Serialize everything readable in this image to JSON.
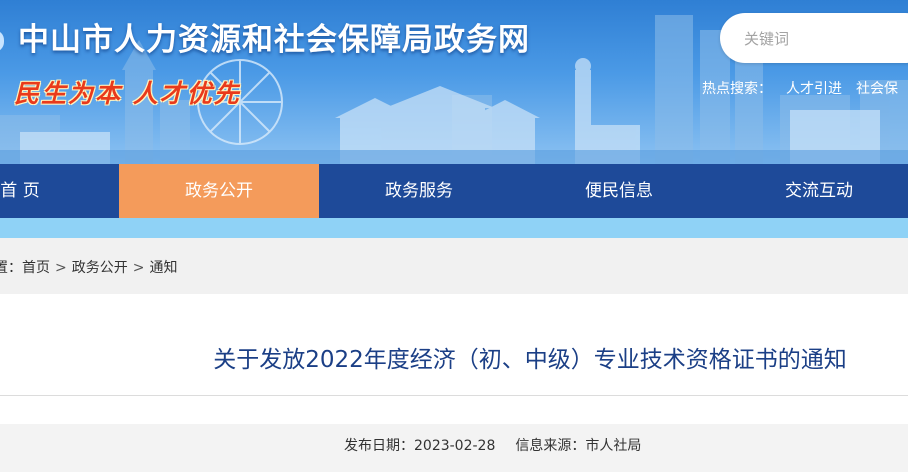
{
  "header": {
    "site_title": "中山市人力资源和社会保障局政务网",
    "slogan": "民生为本  人才优先",
    "search_placeholder": "关键词",
    "hot_label": "热点搜索：",
    "hot_keywords": [
      "人才引进",
      "社会保"
    ]
  },
  "nav": {
    "items": [
      {
        "label": "首 页"
      },
      {
        "label": "政务公开",
        "active": true
      },
      {
        "label": "政务服务"
      },
      {
        "label": "便民信息"
      },
      {
        "label": "交流互动"
      }
    ]
  },
  "breadcrumb": {
    "prefix": "置：",
    "items": [
      "首页",
      "政务公开",
      "通知"
    ],
    "separator": ">"
  },
  "article": {
    "title": "关于发放2022年度经济（初、中级）专业技术资格证书的通知",
    "publish_label": "发布日期：",
    "publish_date": "2023-02-28",
    "source_label": "信息来源：",
    "source": "市人社局"
  },
  "colors": {
    "nav_bg": "#1e4a99",
    "nav_active": "#f49b5b",
    "title_color": "#1b3f86",
    "slogan_red": "#e93a1b"
  }
}
